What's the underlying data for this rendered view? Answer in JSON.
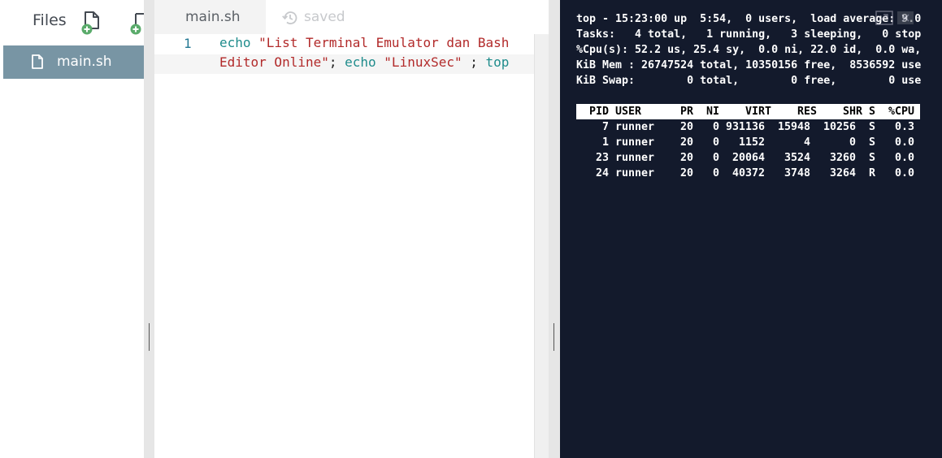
{
  "sidebar": {
    "title": "Files",
    "files": [
      {
        "name": "main.sh"
      }
    ]
  },
  "editor": {
    "tab_label": "main.sh",
    "status": "saved",
    "line_number": "1",
    "code": {
      "line1": [
        {
          "t": "kw",
          "v": "echo"
        },
        {
          "t": "plain",
          "v": " "
        },
        {
          "t": "str",
          "v": "\"List Terminal Emulator dan Bash"
        }
      ],
      "line2": [
        {
          "t": "str",
          "v": "Editor Online\""
        },
        {
          "t": "plain",
          "v": "; "
        },
        {
          "t": "kw",
          "v": "echo"
        },
        {
          "t": "plain",
          "v": " "
        },
        {
          "t": "str",
          "v": "\"LinuxSec\""
        },
        {
          "t": "plain",
          "v": " ; "
        },
        {
          "t": "kw",
          "v": "top"
        }
      ]
    }
  },
  "terminal": {
    "summary": [
      "top - 15:23:00 up  5:54,  0 users,  load average: 9.0",
      "Tasks:   4 total,   1 running,   3 sleeping,   0 stop",
      "%Cpu(s): 52.2 us, 25.4 sy,  0.0 ni, 22.0 id,  0.0 wa,",
      "KiB Mem : 26747524 total, 10350156 free,  8536592 use",
      "KiB Swap:        0 total,        0 free,        0 use"
    ],
    "columns": [
      "PID",
      "USER",
      "PR",
      "NI",
      "VIRT",
      "RES",
      "SHR",
      "S",
      "%CPU"
    ],
    "processes": [
      {
        "pid": "7",
        "user": "runner",
        "pr": "20",
        "ni": "0",
        "virt": "931136",
        "res": "15948",
        "shr": "10256",
        "s": "S",
        "cpu": "0.3"
      },
      {
        "pid": "1",
        "user": "runner",
        "pr": "20",
        "ni": "0",
        "virt": "1152",
        "res": "4",
        "shr": "0",
        "s": "S",
        "cpu": "0.0"
      },
      {
        "pid": "23",
        "user": "runner",
        "pr": "20",
        "ni": "0",
        "virt": "20064",
        "res": "3524",
        "shr": "3260",
        "s": "S",
        "cpu": "0.0"
      },
      {
        "pid": "24",
        "user": "runner",
        "pr": "20",
        "ni": "0",
        "virt": "40372",
        "res": "3748",
        "shr": "3264",
        "s": "R",
        "cpu": "0.0"
      }
    ]
  },
  "colors": {
    "sidebar_selected": "#7895a4",
    "terminal_bg": "#131a2c",
    "keyword": "#1f8c8c",
    "string": "#b22a2a"
  },
  "icons": {
    "new_file": "new-file-icon",
    "new_folder": "new-folder-icon",
    "file": "file-icon",
    "history": "history-icon"
  }
}
